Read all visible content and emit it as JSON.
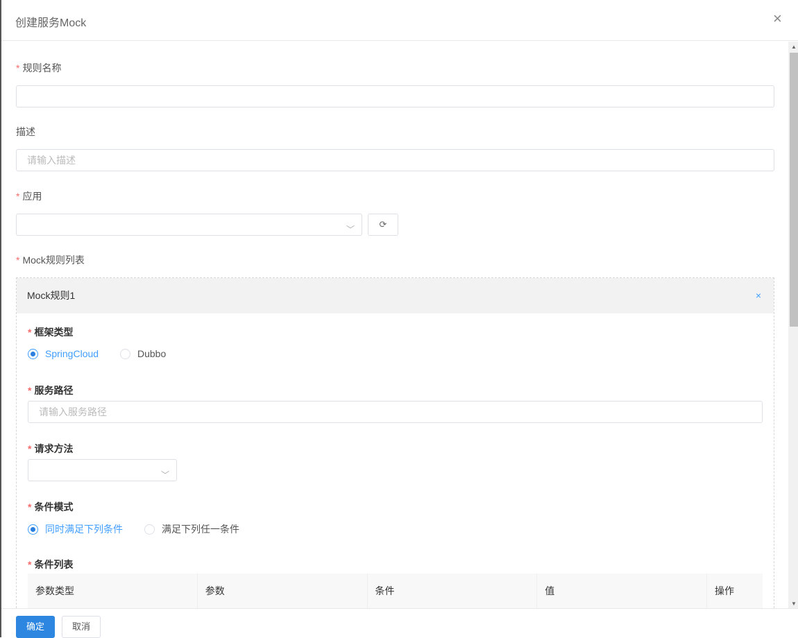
{
  "dialog": {
    "title": "创建服务Mock",
    "close_icon": "×"
  },
  "form": {
    "rule_name": {
      "label": "规则名称",
      "value": "",
      "placeholder": ""
    },
    "description": {
      "label": "描述",
      "placeholder": "请输入描述"
    },
    "app": {
      "label": "应用",
      "value": ""
    },
    "mock_list": {
      "label": "Mock规则列表"
    }
  },
  "rule": {
    "title": "Mock规则1",
    "remove": "×",
    "framework": {
      "label": "框架类型",
      "options": [
        "SpringCloud",
        "Dubbo"
      ],
      "selected": "SpringCloud"
    },
    "service_path": {
      "label": "服务路径",
      "placeholder": "请输入服务路径"
    },
    "method": {
      "label": "请求方法",
      "value": ""
    },
    "condition_mode": {
      "label": "条件模式",
      "options": [
        "同时满足下列条件",
        "满足下列任一条件"
      ],
      "selected": "同时满足下列条件"
    },
    "conditions": {
      "label": "条件列表",
      "columns": [
        "参数类型",
        "参数",
        "条件",
        "值",
        "操作"
      ]
    }
  },
  "footer": {
    "confirm": "确定",
    "cancel": "取消"
  }
}
